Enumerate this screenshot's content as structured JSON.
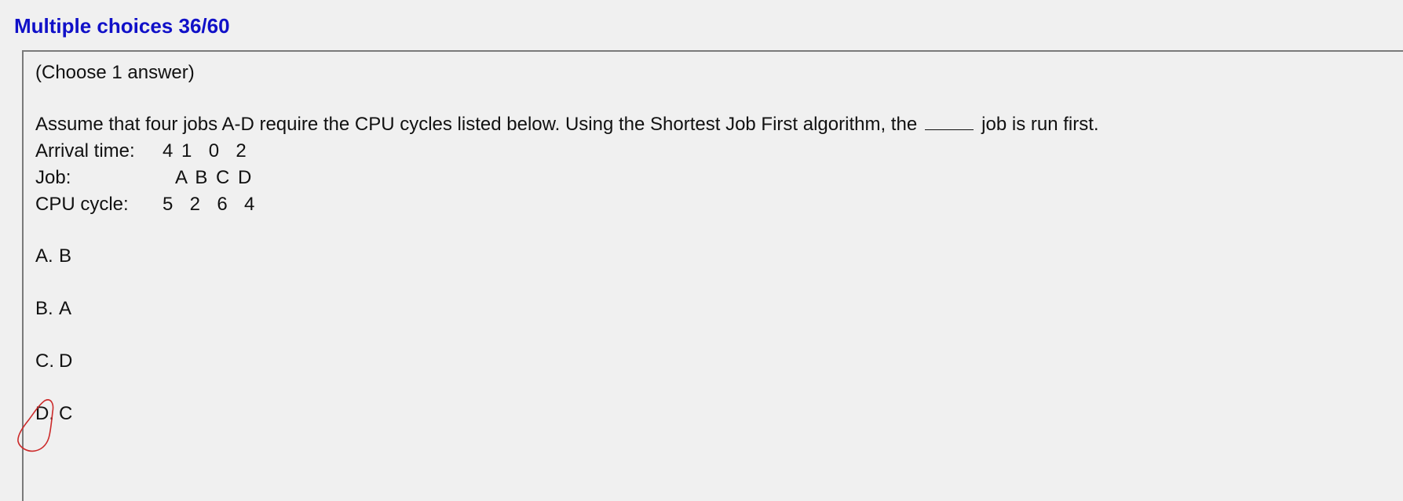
{
  "header": {
    "title": "Multiple choices 36/60"
  },
  "question": {
    "instruction": "(Choose 1 answer)",
    "stem_before": "Assume that four jobs A-D require the CPU cycles listed below. Using the Shortest Job First algorithm, the",
    "stem_after": "job is run first.",
    "table": [
      {
        "label": "Arrival time:",
        "values": "4 1  0  2"
      },
      {
        "label": "Job:",
        "values": "A B C D"
      },
      {
        "label": "CPU cycle:",
        "values": "5  2  6  4"
      }
    ]
  },
  "options": [
    {
      "letter": "A.",
      "text": "B"
    },
    {
      "letter": "B.",
      "text": "A"
    },
    {
      "letter": "C.",
      "text": "D"
    },
    {
      "letter": "D.",
      "text": "C"
    }
  ],
  "annotation": {
    "color": "#cc2a2a"
  }
}
